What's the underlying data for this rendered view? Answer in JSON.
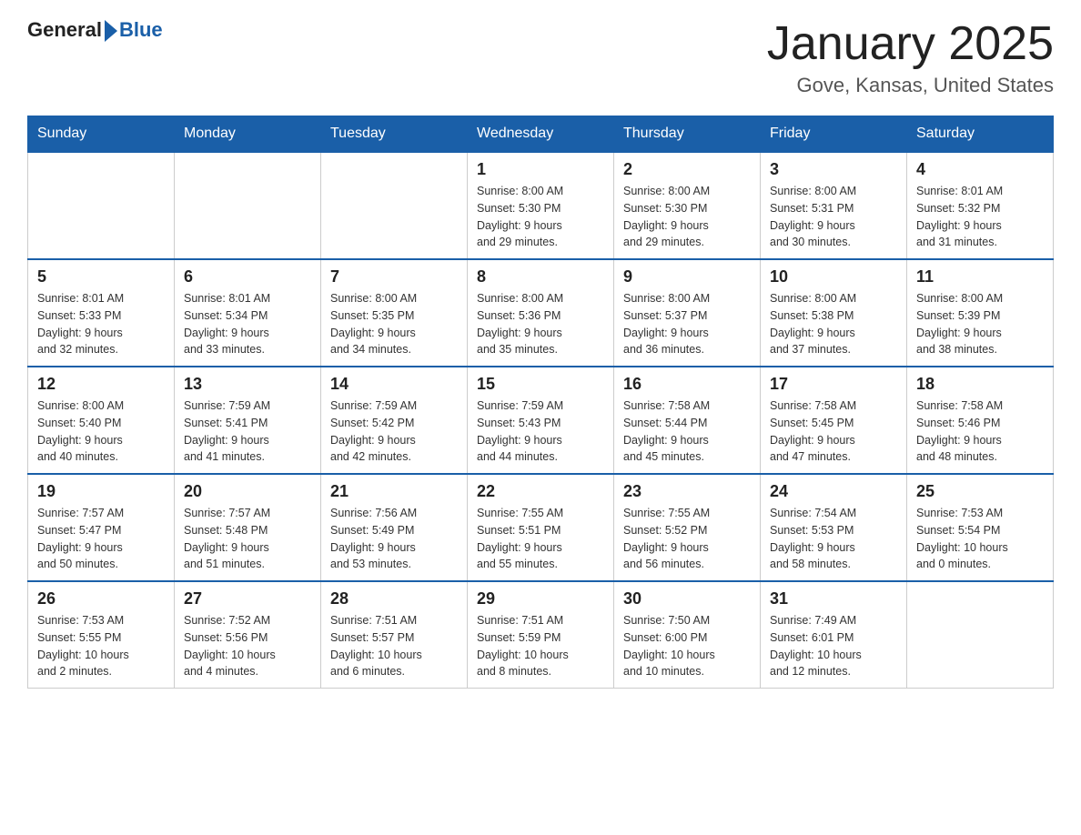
{
  "header": {
    "logo_general": "General",
    "logo_blue": "Blue",
    "month_title": "January 2025",
    "location": "Gove, Kansas, United States"
  },
  "days_of_week": [
    "Sunday",
    "Monday",
    "Tuesday",
    "Wednesday",
    "Thursday",
    "Friday",
    "Saturday"
  ],
  "weeks": [
    [
      {
        "day": "",
        "info": ""
      },
      {
        "day": "",
        "info": ""
      },
      {
        "day": "",
        "info": ""
      },
      {
        "day": "1",
        "info": "Sunrise: 8:00 AM\nSunset: 5:30 PM\nDaylight: 9 hours\nand 29 minutes."
      },
      {
        "day": "2",
        "info": "Sunrise: 8:00 AM\nSunset: 5:30 PM\nDaylight: 9 hours\nand 29 minutes."
      },
      {
        "day": "3",
        "info": "Sunrise: 8:00 AM\nSunset: 5:31 PM\nDaylight: 9 hours\nand 30 minutes."
      },
      {
        "day": "4",
        "info": "Sunrise: 8:01 AM\nSunset: 5:32 PM\nDaylight: 9 hours\nand 31 minutes."
      }
    ],
    [
      {
        "day": "5",
        "info": "Sunrise: 8:01 AM\nSunset: 5:33 PM\nDaylight: 9 hours\nand 32 minutes."
      },
      {
        "day": "6",
        "info": "Sunrise: 8:01 AM\nSunset: 5:34 PM\nDaylight: 9 hours\nand 33 minutes."
      },
      {
        "day": "7",
        "info": "Sunrise: 8:00 AM\nSunset: 5:35 PM\nDaylight: 9 hours\nand 34 minutes."
      },
      {
        "day": "8",
        "info": "Sunrise: 8:00 AM\nSunset: 5:36 PM\nDaylight: 9 hours\nand 35 minutes."
      },
      {
        "day": "9",
        "info": "Sunrise: 8:00 AM\nSunset: 5:37 PM\nDaylight: 9 hours\nand 36 minutes."
      },
      {
        "day": "10",
        "info": "Sunrise: 8:00 AM\nSunset: 5:38 PM\nDaylight: 9 hours\nand 37 minutes."
      },
      {
        "day": "11",
        "info": "Sunrise: 8:00 AM\nSunset: 5:39 PM\nDaylight: 9 hours\nand 38 minutes."
      }
    ],
    [
      {
        "day": "12",
        "info": "Sunrise: 8:00 AM\nSunset: 5:40 PM\nDaylight: 9 hours\nand 40 minutes."
      },
      {
        "day": "13",
        "info": "Sunrise: 7:59 AM\nSunset: 5:41 PM\nDaylight: 9 hours\nand 41 minutes."
      },
      {
        "day": "14",
        "info": "Sunrise: 7:59 AM\nSunset: 5:42 PM\nDaylight: 9 hours\nand 42 minutes."
      },
      {
        "day": "15",
        "info": "Sunrise: 7:59 AM\nSunset: 5:43 PM\nDaylight: 9 hours\nand 44 minutes."
      },
      {
        "day": "16",
        "info": "Sunrise: 7:58 AM\nSunset: 5:44 PM\nDaylight: 9 hours\nand 45 minutes."
      },
      {
        "day": "17",
        "info": "Sunrise: 7:58 AM\nSunset: 5:45 PM\nDaylight: 9 hours\nand 47 minutes."
      },
      {
        "day": "18",
        "info": "Sunrise: 7:58 AM\nSunset: 5:46 PM\nDaylight: 9 hours\nand 48 minutes."
      }
    ],
    [
      {
        "day": "19",
        "info": "Sunrise: 7:57 AM\nSunset: 5:47 PM\nDaylight: 9 hours\nand 50 minutes."
      },
      {
        "day": "20",
        "info": "Sunrise: 7:57 AM\nSunset: 5:48 PM\nDaylight: 9 hours\nand 51 minutes."
      },
      {
        "day": "21",
        "info": "Sunrise: 7:56 AM\nSunset: 5:49 PM\nDaylight: 9 hours\nand 53 minutes."
      },
      {
        "day": "22",
        "info": "Sunrise: 7:55 AM\nSunset: 5:51 PM\nDaylight: 9 hours\nand 55 minutes."
      },
      {
        "day": "23",
        "info": "Sunrise: 7:55 AM\nSunset: 5:52 PM\nDaylight: 9 hours\nand 56 minutes."
      },
      {
        "day": "24",
        "info": "Sunrise: 7:54 AM\nSunset: 5:53 PM\nDaylight: 9 hours\nand 58 minutes."
      },
      {
        "day": "25",
        "info": "Sunrise: 7:53 AM\nSunset: 5:54 PM\nDaylight: 10 hours\nand 0 minutes."
      }
    ],
    [
      {
        "day": "26",
        "info": "Sunrise: 7:53 AM\nSunset: 5:55 PM\nDaylight: 10 hours\nand 2 minutes."
      },
      {
        "day": "27",
        "info": "Sunrise: 7:52 AM\nSunset: 5:56 PM\nDaylight: 10 hours\nand 4 minutes."
      },
      {
        "day": "28",
        "info": "Sunrise: 7:51 AM\nSunset: 5:57 PM\nDaylight: 10 hours\nand 6 minutes."
      },
      {
        "day": "29",
        "info": "Sunrise: 7:51 AM\nSunset: 5:59 PM\nDaylight: 10 hours\nand 8 minutes."
      },
      {
        "day": "30",
        "info": "Sunrise: 7:50 AM\nSunset: 6:00 PM\nDaylight: 10 hours\nand 10 minutes."
      },
      {
        "day": "31",
        "info": "Sunrise: 7:49 AM\nSunset: 6:01 PM\nDaylight: 10 hours\nand 12 minutes."
      },
      {
        "day": "",
        "info": ""
      }
    ]
  ]
}
